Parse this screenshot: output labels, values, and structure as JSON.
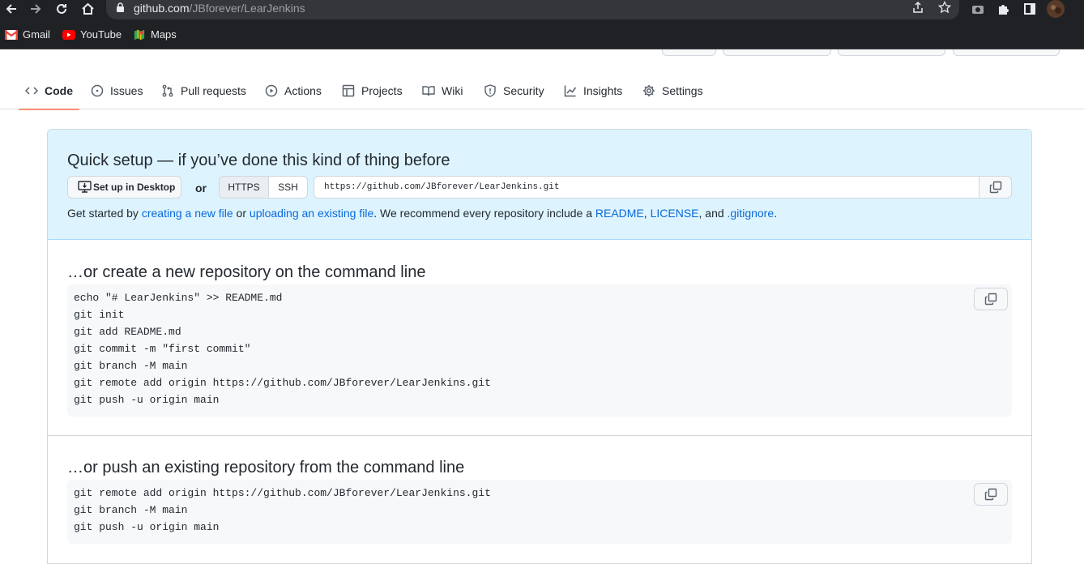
{
  "browser": {
    "url_host": "github.com",
    "url_path": "/JBforever/LearJenkins",
    "bookmarks": [
      {
        "label": "Gmail",
        "icon": "gmail-icon"
      },
      {
        "label": "YouTube",
        "icon": "youtube-icon"
      },
      {
        "label": "Maps",
        "icon": "maps-icon"
      }
    ]
  },
  "repo_nav": {
    "tabs": [
      {
        "label": "Code",
        "icon": "code-icon",
        "active": true
      },
      {
        "label": "Issues",
        "icon": "issue-icon"
      },
      {
        "label": "Pull requests",
        "icon": "pull-request-icon"
      },
      {
        "label": "Actions",
        "icon": "play-icon"
      },
      {
        "label": "Projects",
        "icon": "table-icon"
      },
      {
        "label": "Wiki",
        "icon": "book-icon"
      },
      {
        "label": "Security",
        "icon": "shield-icon"
      },
      {
        "label": "Insights",
        "icon": "graph-icon"
      },
      {
        "label": "Settings",
        "icon": "gear-icon"
      }
    ]
  },
  "quick_setup": {
    "title": "Quick setup — if you’ve done this kind of thing before",
    "desktop_button": "Set up in Desktop",
    "or": "or",
    "https": "HTTPS",
    "ssh": "SSH",
    "clone_url": "https://github.com/JBforever/LearJenkins.git",
    "started_prefix": "Get started by ",
    "link_new_file": "creating a new file",
    "or_word": " or ",
    "link_upload": "uploading an existing file",
    "recommend": ". We recommend every repository include a ",
    "link_readme": "README",
    "comma1": ", ",
    "link_license": "LICENSE",
    "comma_and": ", and ",
    "link_gitignore": ".gitignore",
    "period": "."
  },
  "create_section": {
    "title": "…or create a new repository on the command line",
    "lines": [
      "echo \"# LearJenkins\" >> README.md",
      "git init",
      "git add README.md",
      "git commit -m \"first commit\"",
      "git branch -M main",
      "git remote add origin https://github.com/JBforever/LearJenkins.git",
      "git push -u origin main"
    ]
  },
  "push_section": {
    "title": "…or push an existing repository from the command line",
    "lines": [
      "git remote add origin https://github.com/JBforever/LearJenkins.git",
      "git branch -M main",
      "git push -u origin main"
    ]
  },
  "colors": {
    "accent_underline": "#fd8c73",
    "link": "#0969da",
    "quick_setup_bg": "#ddf4ff",
    "chrome_bg": "#202124"
  }
}
